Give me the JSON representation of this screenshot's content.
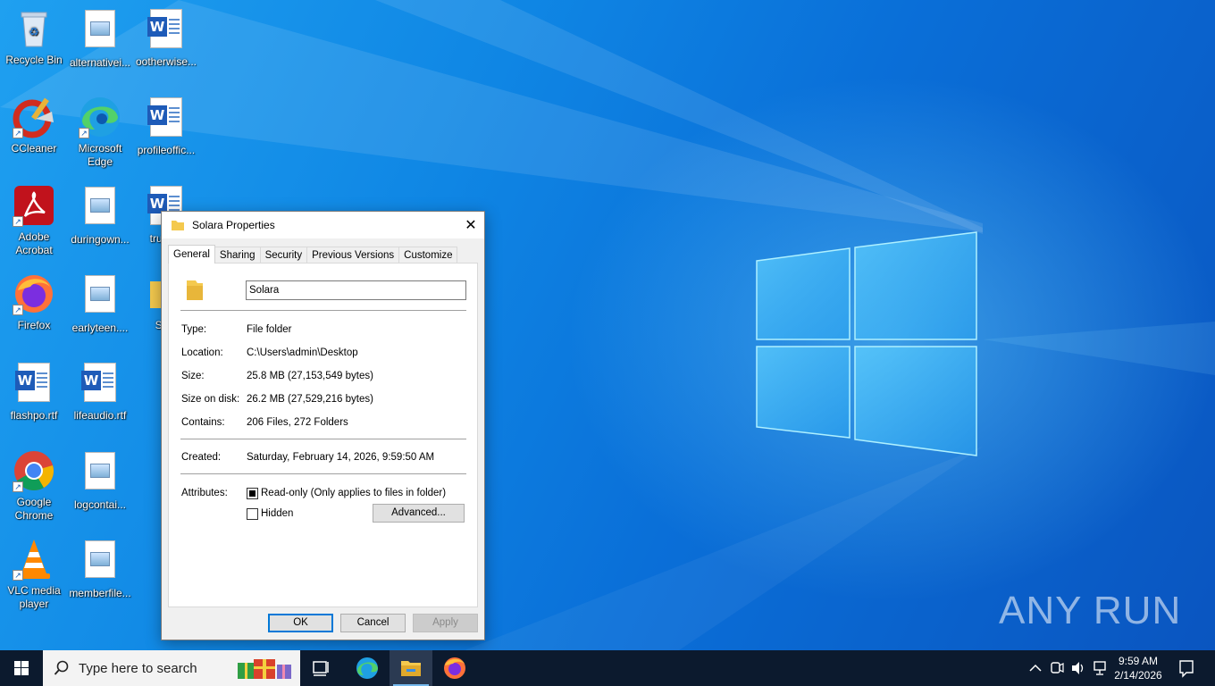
{
  "desktop": {
    "icons": [
      {
        "label": "Recycle Bin"
      },
      {
        "label": "alternativei..."
      },
      {
        "label": "ootherwise..."
      },
      {
        "label": "CCleaner"
      },
      {
        "label": "Microsoft Edge"
      },
      {
        "label": "profileoffic..."
      },
      {
        "label": "Adobe Acrobat"
      },
      {
        "label": "duringown..."
      },
      {
        "label": "trues..."
      },
      {
        "label": "Firefox"
      },
      {
        "label": "earlyteen...."
      },
      {
        "label": "So..."
      },
      {
        "label": "flashpo.rtf"
      },
      {
        "label": "lifeaudio.rtf"
      },
      {
        "label": "Google Chrome"
      },
      {
        "label": "logcontai..."
      },
      {
        "label": "VLC media player"
      },
      {
        "label": "memberfile..."
      }
    ],
    "watermark": "ANY RUN"
  },
  "dialog": {
    "title": "Solara Properties",
    "close_label": "✕",
    "tabs": [
      {
        "label": "General",
        "active": true
      },
      {
        "label": "Sharing"
      },
      {
        "label": "Security"
      },
      {
        "label": "Previous Versions"
      },
      {
        "label": "Customize"
      }
    ],
    "name_value": "Solara",
    "props": [
      {
        "label": "Type:",
        "value": "File folder"
      },
      {
        "label": "Location:",
        "value": "C:\\Users\\admin\\Desktop"
      },
      {
        "label": "Size:",
        "value": "25.8 MB (27,153,549 bytes)"
      },
      {
        "label": "Size on disk:",
        "value": "26.2 MB (27,529,216 bytes)"
      },
      {
        "label": "Contains:",
        "value": "206 Files, 272 Folders"
      }
    ],
    "created": {
      "label": "Created:",
      "value": "Saturday, February 14, 2026, 9:59:50 AM"
    },
    "attributes": {
      "label": "Attributes:",
      "readonly_label": "Read-only (Only applies to files in folder)",
      "readonly_checked": true,
      "hidden_label": "Hidden",
      "hidden_checked": false,
      "advanced_label": "Advanced..."
    },
    "buttons": {
      "ok": "OK",
      "cancel": "Cancel",
      "apply": "Apply"
    }
  },
  "taskbar": {
    "search_placeholder": "Type here to search",
    "clock": {
      "time": "9:59 AM",
      "date": "2/14/2026"
    }
  }
}
